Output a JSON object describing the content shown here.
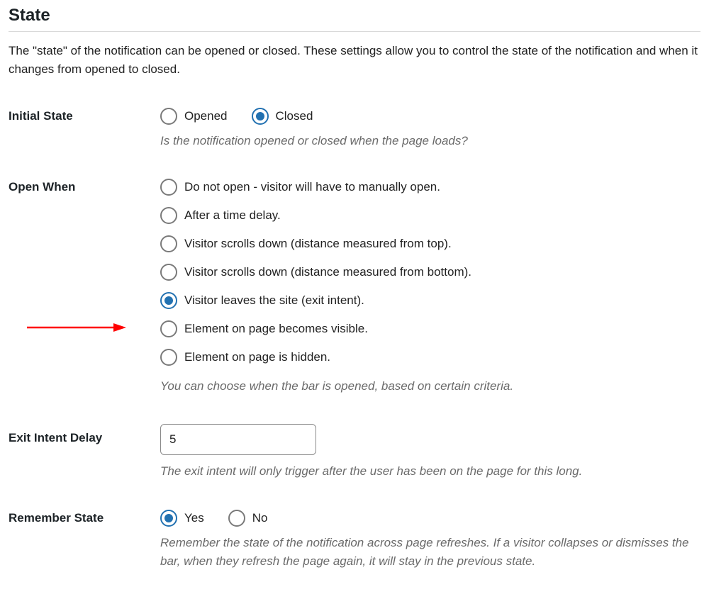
{
  "section": {
    "title": "State",
    "description": "The \"state\" of the notification can be opened or closed. These settings allow you to control the state of the notification and when it changes from opened to closed."
  },
  "fields": {
    "initial_state": {
      "label": "Initial State",
      "options": {
        "opened": "Opened",
        "closed": "Closed"
      },
      "selected": "closed",
      "helper": "Is the notification opened or closed when the page loads?"
    },
    "open_when": {
      "label": "Open When",
      "options": [
        "Do not open - visitor will have to manually open.",
        "After a time delay.",
        "Visitor scrolls down (distance measured from top).",
        "Visitor scrolls down (distance measured from bottom).",
        "Visitor leaves the site (exit intent).",
        "Element on page becomes visible.",
        "Element on page is hidden."
      ],
      "selected_index": 4,
      "helper": "You can choose when the bar is opened, based on certain criteria."
    },
    "exit_intent_delay": {
      "label": "Exit Intent Delay",
      "value": "5",
      "helper": "The exit intent will only trigger after the user has been on the page for this long."
    },
    "remember_state": {
      "label": "Remember State",
      "options": {
        "yes": "Yes",
        "no": "No"
      },
      "selected": "yes",
      "helper": "Remember the state of the notification across page refreshes. If a visitor collapses or dismisses the bar, when they refresh the page again, it will stay in the previous state."
    }
  }
}
